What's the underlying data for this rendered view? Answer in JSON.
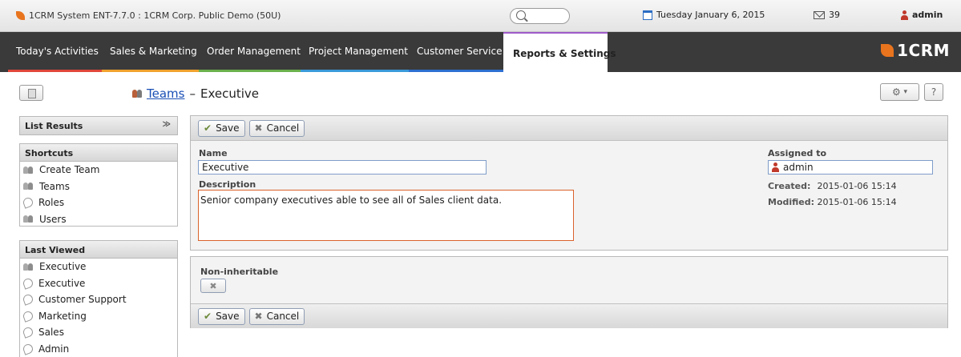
{
  "topbar": {
    "app_title": "1CRM System ENT-7.7.0 : 1CRM Corp. Public Demo (50U)",
    "date": "Tuesday January 6, 2015",
    "mail_count": "39",
    "user": "admin"
  },
  "nav": {
    "tabs": [
      {
        "label": "Today's Activities",
        "color": "#e0473a"
      },
      {
        "label": "Sales & Marketing",
        "color": "#f0a22e"
      },
      {
        "label": "Order Management",
        "color": "#6ab04c"
      },
      {
        "label": "Project Management",
        "color": "#3a9ad9"
      },
      {
        "label": "Customer Service",
        "color": "#2e6fd1"
      },
      {
        "label": "Reports & Settings",
        "color": "#a05bc9"
      }
    ],
    "brand": "1CRM"
  },
  "page": {
    "breadcrumb_link": "Teams",
    "separator": "–",
    "title": "Executive"
  },
  "sidebar": {
    "list_results": "List Results",
    "shortcuts_title": "Shortcuts",
    "shortcuts": [
      {
        "label": "Create Team",
        "icon": "team-icon"
      },
      {
        "label": "Teams",
        "icon": "team-icon"
      },
      {
        "label": "Roles",
        "icon": "role-icon"
      },
      {
        "label": "Users",
        "icon": "users-icon"
      }
    ],
    "last_viewed_title": "Last Viewed",
    "last_viewed": [
      {
        "label": "Executive",
        "icon": "team-icon"
      },
      {
        "label": "Executive",
        "icon": "role-icon"
      },
      {
        "label": "Customer Support",
        "icon": "role-icon"
      },
      {
        "label": "Marketing",
        "icon": "role-icon"
      },
      {
        "label": "Sales",
        "icon": "role-icon"
      },
      {
        "label": "Admin",
        "icon": "role-icon"
      }
    ]
  },
  "form": {
    "save_label": "Save",
    "cancel_label": "Cancel",
    "name_label": "Name",
    "name_value": "Executive",
    "description_label": "Description",
    "description_value": "Senior company executives able to see all of Sales client data.",
    "assigned_label": "Assigned to",
    "assigned_value": "admin",
    "created_label": "Created:",
    "created_value": "2015-01-06 15:14",
    "modified_label": "Modified:",
    "modified_value": "2015-01-06 15:14",
    "non_inheritable_label": "Non-inheritable"
  }
}
